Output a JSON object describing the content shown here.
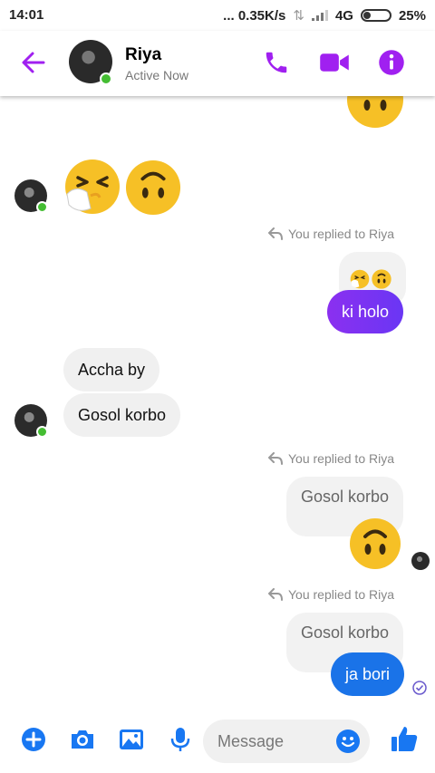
{
  "status_bar": {
    "time": "14:01",
    "network_speed": "... 0.35K/s",
    "network_type": "4G",
    "battery": "25%"
  },
  "header": {
    "contact_name": "Riya",
    "presence": "Active Now"
  },
  "colors": {
    "accent": "#a020f0",
    "sent_purple": "#7b2ff7",
    "sent_blue": "#1a73e8",
    "online": "#44bd32",
    "emoji": "#f6c026"
  },
  "messages": {
    "reply_note_1": "You replied to Riya",
    "reply_note_2": "You replied to Riya",
    "reply_note_3": "You replied to Riya",
    "sent_1": "ki holo",
    "recv_1": "Accha by",
    "recv_2": "Gosol korbo",
    "quoted_2": "Gosol korbo",
    "quoted_3": "Gosol korbo",
    "sent_2": "ja bori"
  },
  "composer": {
    "placeholder": "Message"
  }
}
